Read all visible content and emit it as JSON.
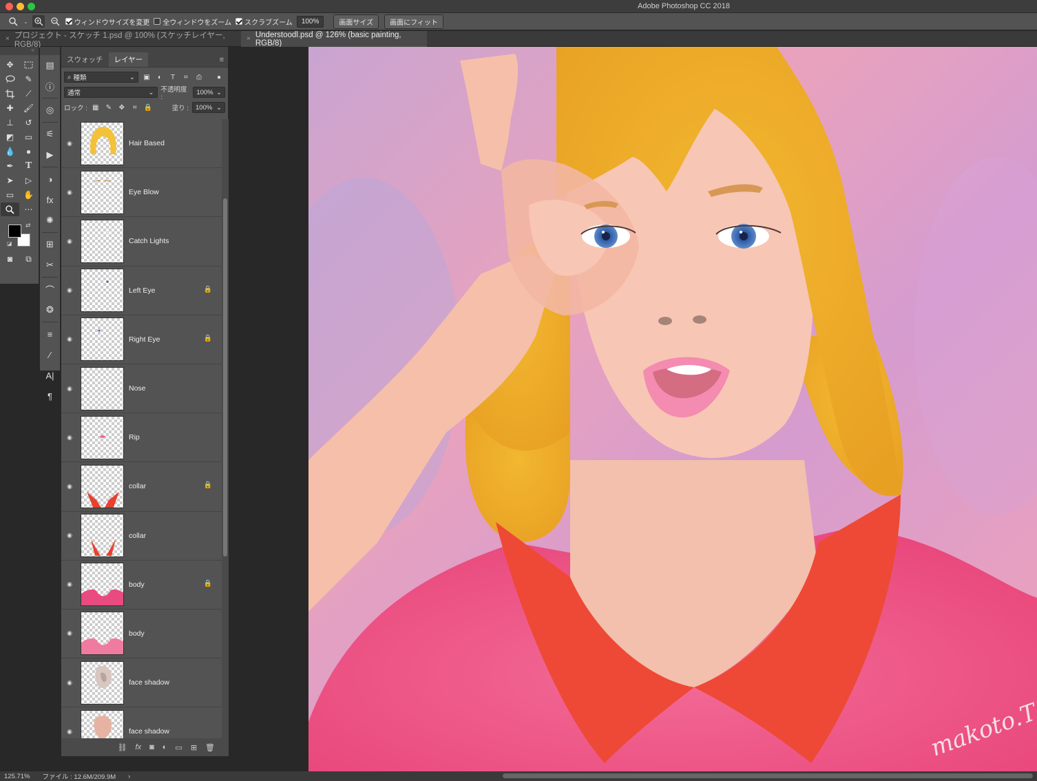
{
  "window": {
    "title": "Adobe Photoshop CC 2018"
  },
  "options": {
    "resize_windows_label": "ウィンドウサイズを変更",
    "zoom_all_label": "全ウィンドウをズーム",
    "scrubby_zoom_label": "スクラブズーム",
    "zoom_value": "100%",
    "actual_pixels_label": "画面サイズ",
    "fit_screen_label": "画面にフィット"
  },
  "tabs": [
    {
      "label": "プロジェクト - スケッチ 1.psd @ 100% (スケッチレイヤー, RGB/8)"
    },
    {
      "label": "Understoodl.psd @ 126% (basic painting, RGB/8)"
    }
  ],
  "panel": {
    "tab_swatches": "スウォッチ",
    "tab_layers": "レイヤー",
    "filter_kind": "種類",
    "blend_mode": "通常",
    "opacity_label": "不透明度 :",
    "opacity_value": "100%",
    "lock_label": "ロック :",
    "fill_label": "塗り :",
    "fill_value": "100%"
  },
  "layers": [
    {
      "name": "Hair Based",
      "locked": false
    },
    {
      "name": "Eye Blow",
      "locked": false
    },
    {
      "name": "Catch Lights",
      "locked": false
    },
    {
      "name": "Left Eye",
      "locked": true
    },
    {
      "name": "Right Eye",
      "locked": true
    },
    {
      "name": "Nose",
      "locked": false
    },
    {
      "name": "Rip",
      "locked": false
    },
    {
      "name": "collar",
      "locked": true
    },
    {
      "name": "collar",
      "locked": false
    },
    {
      "name": "body",
      "locked": true
    },
    {
      "name": "body",
      "locked": false
    },
    {
      "name": "face shadow",
      "locked": false
    },
    {
      "name": "face shadow",
      "locked": false
    }
  ],
  "canvas": {
    "signature": "makoto.T"
  },
  "status": {
    "zoom": "125.71%",
    "file_info": "ファイル : 12.6M/209.9M"
  },
  "icons": [
    "zoom-icon",
    "eye-icon",
    "lock-icon",
    "move-icon",
    "marquee-icon",
    "lasso-icon",
    "crop-icon",
    "brush-icon",
    "type-icon",
    "hand-icon",
    "trash-icon",
    "fx-icon",
    "link-icon",
    "folder-icon",
    "new-layer-icon",
    "mask-icon",
    "adjustment-icon"
  ]
}
